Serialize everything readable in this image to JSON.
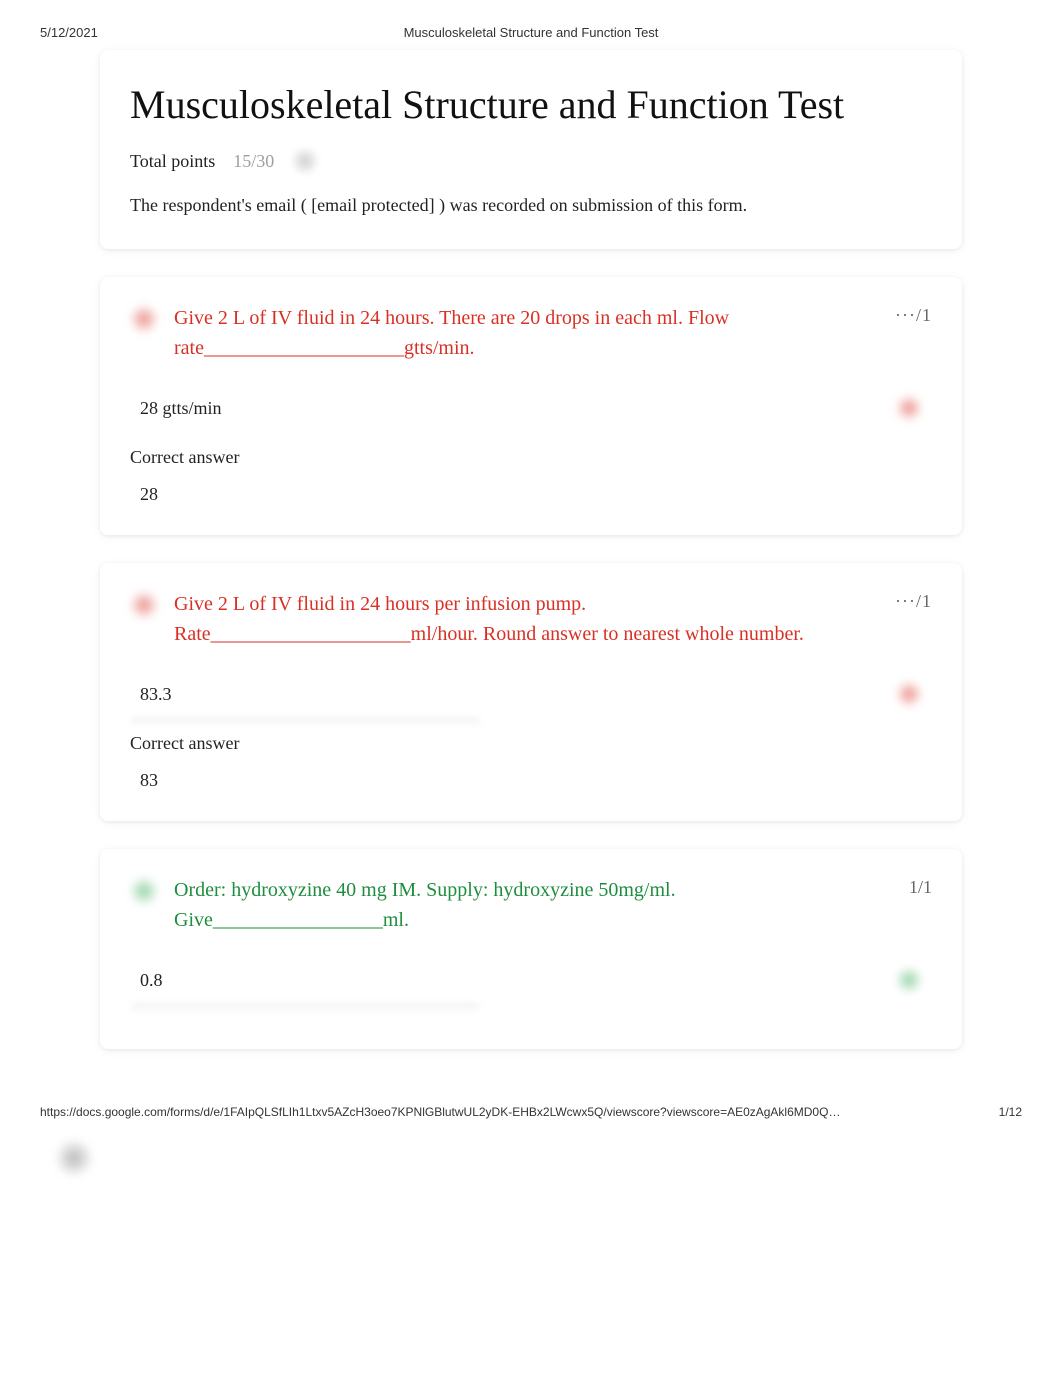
{
  "header": {
    "date": "5/12/2021",
    "title": "Musculoskeletal Structure and Function Test"
  },
  "form": {
    "title": "Musculoskeletal Structure and Function Test",
    "points_label": "Total points",
    "points_value": "15/30",
    "email_prefix": "The respondent's email (",
    "email_value": "[email protected]",
    "email_suffix": ") was recorded on submission of this form."
  },
  "questions": [
    {
      "status": "wrong",
      "text": "Give 2 L of IV fluid in 24 hours. There are 20 drops in each ml. Flow rate____________________gtts/min.",
      "score": "···/1",
      "user_answer": "28 gtts/min",
      "correct_label": "Correct answer",
      "correct_answer": "28"
    },
    {
      "status": "wrong",
      "text": "Give 2 L of IV fluid in 24 hours per infusion pump. Rate____________________ml/hour. Round answer to nearest whole number.",
      "score": "···/1",
      "user_answer": "83.3",
      "correct_label": "Correct answer",
      "correct_answer": "83"
    },
    {
      "status": "correct",
      "text": "Order: hydroxyzine 40 mg IM. Supply: hydroxyzine 50mg/ml. Give_________________ml.",
      "score": "1/1",
      "user_answer": "0.8"
    }
  ],
  "footer": {
    "url": "https://docs.google.com/forms/d/e/1FAIpQLSfLIh1Ltxv5AZcH3oeo7KPNlGBlutwUL2yDK-EHBx2LWcwx5Q/viewscore?viewscore=AE0zAgAkl6MD0Q…",
    "page": "1/12"
  }
}
